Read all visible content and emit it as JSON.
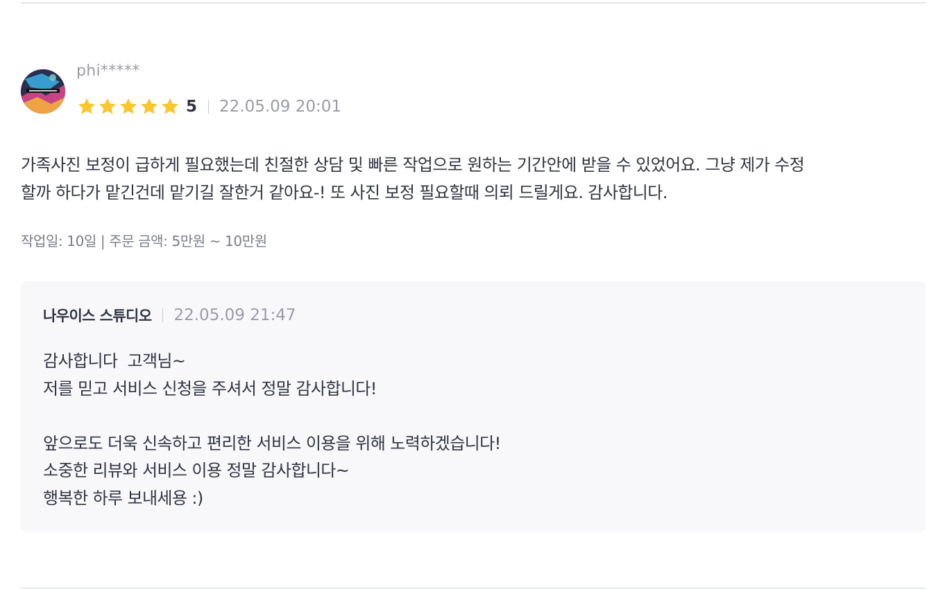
{
  "review": {
    "username": "phi*****",
    "avatar_icon": "profile-photo-avatar",
    "rating": {
      "stars_filled": 5,
      "stars_total": 5,
      "star_color": "#fcc72c",
      "value": "5"
    },
    "date": "22.05.09 20:01",
    "body_lines": [
      "가족사진 보정이 급하게 필요했는데 친절한 상담 및 빠른 작업으로 원하는 기간안에 받을 수 있었어요. 그냥 제가 수정",
      "할까 하다가 맡긴건데 맡기길 잘한거 같아요-! 또 사진 보정 필요할때 의뢰 드릴게요. 감사합니다."
    ],
    "meta": "작업일: 10일 | 주문 금액: 5만원 ~ 10만원"
  },
  "reply": {
    "author": "나우이스 스튜디오",
    "date": "22.05.09 21:47",
    "lines": [
      "감사합니다  고객님~",
      "저를 믿고 서비스 신청을 주셔서 정말 감사합니다!",
      "",
      "앞으로도 더욱 신속하고 편리한 서비스 이용을 위해 노력하겠습니다!",
      "소중한 리뷰와 서비스 이용 정말 감사합니다~",
      "행복한 하루 보내세용 :)"
    ],
    "background_color": "#f8f8fb"
  }
}
